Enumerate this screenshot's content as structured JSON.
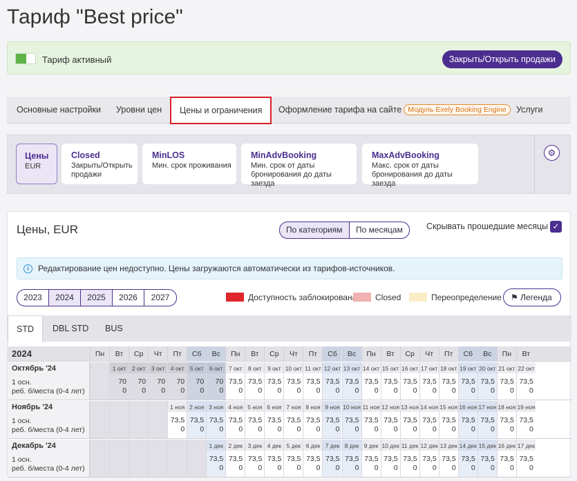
{
  "page": {
    "title": "Тариф \"Best price\""
  },
  "status": {
    "label": "Тариф активный",
    "sales_button": "Закрыть/Открыть продажи"
  },
  "tabs": [
    {
      "label": "Основные настройки"
    },
    {
      "label": "Уровни цен"
    },
    {
      "label": "Цены и ограничения"
    },
    {
      "label": "Оформление тарифа на сайте",
      "badge": "Модуль Exely Booking Engine"
    },
    {
      "label": "Услуги"
    }
  ],
  "cards": [
    {
      "title": "Цены",
      "sub": "EUR"
    },
    {
      "title": "Closed",
      "sub": "Закрыть/Открыть продажи"
    },
    {
      "title": "MinLOS",
      "sub": "Мин. срок проживания"
    },
    {
      "title": "MinAdvBooking",
      "sub": "Мин. срок от даты бронирования до даты заезда"
    },
    {
      "title": "MaxAdvBooking",
      "sub": "Макс. срок от даты бронирования до даты заезда"
    }
  ],
  "panel": {
    "title": "Цены, EUR",
    "by_category": "По категориям",
    "by_month": "По месяцам",
    "hide_past": "Скрывать прошедшие месяцы",
    "info": "Редактирование цен недоступно. Цены загружаются автоматически из тарифов-источников.",
    "years": [
      "2023",
      "2024",
      "2025",
      "2026",
      "2027"
    ],
    "legend_items": [
      {
        "label": "Доступность заблокирована",
        "color": "#e0252b"
      },
      {
        "label": "Closed",
        "color": "#f2b1b1"
      },
      {
        "label": "Переопределение",
        "color": "#fbeec6"
      }
    ],
    "legend_button": "Легенда",
    "room_tabs": [
      "STD",
      "DBL STD",
      "BUS"
    ]
  },
  "grid": {
    "year": "2024",
    "weekdays": [
      "Пн",
      "Вт",
      "Ср",
      "Чт",
      "Пт",
      "Сб",
      "Вс",
      "Пн",
      "Вт",
      "Ср",
      "Чт",
      "Пт",
      "Сб",
      "Вс",
      "Пн",
      "Вт",
      "Ср",
      "Чт",
      "Пт",
      "Сб",
      "Вс",
      "Пн",
      "Вт"
    ],
    "row1": "1 осн.",
    "row2": "реб. б/места (0-4 лет)",
    "months": [
      {
        "name": "Октябрь '24",
        "offset": 1,
        "start_day": 1,
        "abbr": "окт",
        "past_until": 6,
        "days": 22,
        "v1": [
          "70",
          "70",
          "70",
          "70",
          "70",
          "70",
          "73,5",
          "73,5",
          "73,5",
          "73,5",
          "73,5",
          "73,5",
          "73,5",
          "73,5",
          "73,5",
          "73,5",
          "73,5",
          "73,5",
          "73,5",
          "73,5",
          "73,5",
          "73,5"
        ]
      },
      {
        "name": "Ноябрь '24",
        "offset": 4,
        "start_day": 1,
        "abbr": "ноя",
        "past_until": 0,
        "days": 19,
        "v1": [
          "73,5",
          "73,5",
          "73,5",
          "73,5",
          "73,5",
          "73,5",
          "73,5",
          "73,5",
          "73,5",
          "73,5",
          "73,5",
          "73,5",
          "73,5",
          "73,5",
          "73,5",
          "73,5",
          "73,5",
          "73,5",
          "73,5"
        ]
      },
      {
        "name": "Декабрь '24",
        "offset": 6,
        "start_day": 1,
        "abbr": "дек",
        "past_until": 0,
        "days": 17,
        "v1": [
          "73,5",
          "73,5",
          "73,5",
          "73,5",
          "73,5",
          "73,5",
          "73,5",
          "73,5",
          "73,5",
          "73,5",
          "73,5",
          "73,5",
          "73,5",
          "73,5",
          "73,5",
          "73,5",
          "73,5"
        ]
      }
    ],
    "v2": "0"
  }
}
